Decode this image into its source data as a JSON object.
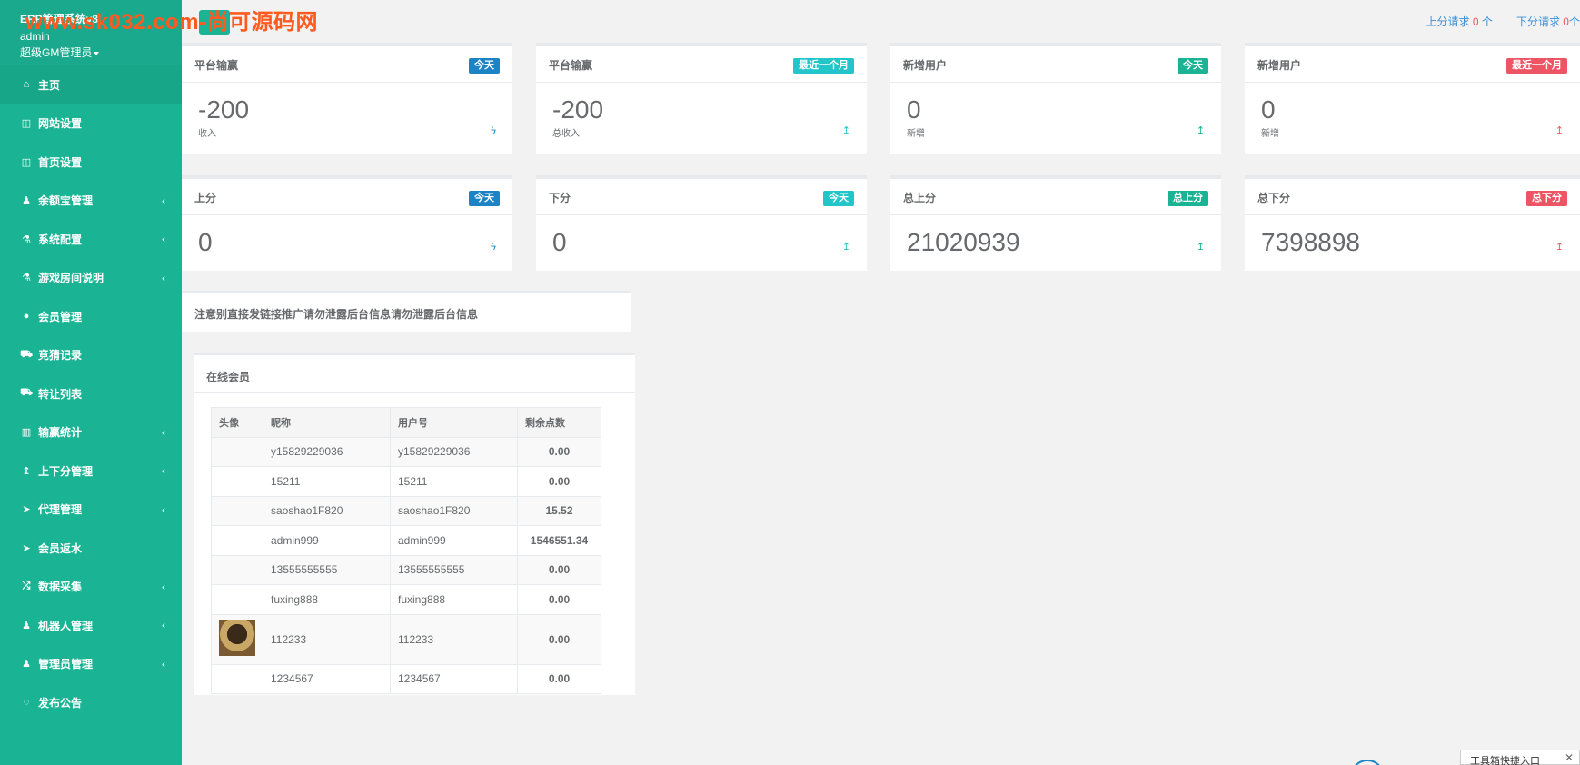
{
  "header": {
    "app_name": "ERP管理系统v8",
    "username": "admin",
    "role": "超级GM管理员",
    "watermark": "www.sk032.com-尚可源码网"
  },
  "topbar": {
    "up_request_label": "上分请求",
    "up_request_count": "0",
    "up_request_unit": "个",
    "down_request_label": "下分请求",
    "down_request_count": "0",
    "down_request_unit": "个"
  },
  "sidebar": {
    "items": [
      {
        "label": "主页",
        "icon": "home-icon",
        "expandable": false,
        "active": true
      },
      {
        "label": "网站设置",
        "icon": "columns-icon",
        "expandable": false
      },
      {
        "label": "首页设置",
        "icon": "columns-icon",
        "expandable": false
      },
      {
        "label": "余额宝管理",
        "icon": "female-icon",
        "expandable": true
      },
      {
        "label": "系统配置",
        "icon": "flask-icon",
        "expandable": true
      },
      {
        "label": "游戏房间说明",
        "icon": "flask-icon",
        "expandable": true
      },
      {
        "label": "会员管理",
        "icon": "user-icon",
        "expandable": false
      },
      {
        "label": "竞猜记录",
        "icon": "car-icon",
        "expandable": false
      },
      {
        "label": "转让列表",
        "icon": "car-icon",
        "expandable": false
      },
      {
        "label": "输赢统计",
        "icon": "chart-icon",
        "expandable": true
      },
      {
        "label": "上下分管理",
        "icon": "level-up-icon",
        "expandable": true
      },
      {
        "label": "代理管理",
        "icon": "paper-plane-icon",
        "expandable": true
      },
      {
        "label": "会员返水",
        "icon": "paper-plane-icon",
        "expandable": false
      },
      {
        "label": "数据采集",
        "icon": "random-icon",
        "expandable": true
      },
      {
        "label": "机器人管理",
        "icon": "female-icon",
        "expandable": true
      },
      {
        "label": "管理员管理",
        "icon": "female-icon",
        "expandable": true
      },
      {
        "label": "发布公告",
        "icon": "comment-icon",
        "expandable": false
      }
    ],
    "arrow": "‹"
  },
  "cards": [
    {
      "title": "平台输赢",
      "badge": "今天",
      "badge_color": "#1c84c6",
      "value": "-200",
      "sub": "收入",
      "icon": "bolt-icon"
    },
    {
      "title": "平台输赢",
      "badge": "最近一个月",
      "badge_color": "#23c6c8",
      "value": "-200",
      "sub": "总收入",
      "icon": "level-up-icon"
    },
    {
      "title": "新增用户",
      "badge": "今天",
      "badge_color": "#1ab394",
      "value": "0",
      "sub": "新增",
      "icon": "level-up-icon"
    },
    {
      "title": "新增用户",
      "badge": "最近一个月",
      "badge_color": "#ed5565",
      "value": "0",
      "sub": "新增",
      "icon": "level-up-icon"
    },
    {
      "title": "上分",
      "badge": "今天",
      "badge_color": "#1c84c6",
      "value": "0",
      "sub": "",
      "icon": "bolt-icon"
    },
    {
      "title": "下分",
      "badge": "今天",
      "badge_color": "#23c6c8",
      "value": "0",
      "sub": "",
      "icon": "level-up-icon"
    },
    {
      "title": "总上分",
      "badge": "总上分",
      "badge_color": "#1ab394",
      "value": "21020939",
      "sub": "",
      "icon": "level-up-icon"
    },
    {
      "title": "总下分",
      "badge": "总下分",
      "badge_color": "#ed5565",
      "value": "7398898",
      "sub": "",
      "icon": "level-up-icon"
    }
  ],
  "notice": "注意别直接发链接推广请勿泄露后台信息请勿泄露后台信息",
  "online_members": {
    "title": "在线会员",
    "columns": [
      "头像",
      "昵称",
      "用户号",
      "剩余点数"
    ],
    "rows": [
      {
        "nickname": "y15829229036",
        "user_no": "y15829229036",
        "points": "0.00",
        "avatar": false
      },
      {
        "nickname": "15211",
        "user_no": "15211",
        "points": "0.00",
        "avatar": false
      },
      {
        "nickname": "saoshao1F820",
        "user_no": "saoshao1F820",
        "points": "15.52",
        "avatar": false
      },
      {
        "nickname": "admin999",
        "user_no": "admin999",
        "points": "1546551.34",
        "avatar": false
      },
      {
        "nickname": "13555555555",
        "user_no": "13555555555",
        "points": "0.00",
        "avatar": false
      },
      {
        "nickname": "fuxing888",
        "user_no": "fuxing888",
        "points": "0.00",
        "avatar": false
      },
      {
        "nickname": "112233",
        "user_no": "112233",
        "points": "0.00",
        "avatar": true
      },
      {
        "nickname": "1234567",
        "user_no": "1234567",
        "points": "0.00",
        "avatar": false
      }
    ]
  },
  "toolbox": {
    "label": "工具箱快捷入口",
    "close": "✕"
  }
}
